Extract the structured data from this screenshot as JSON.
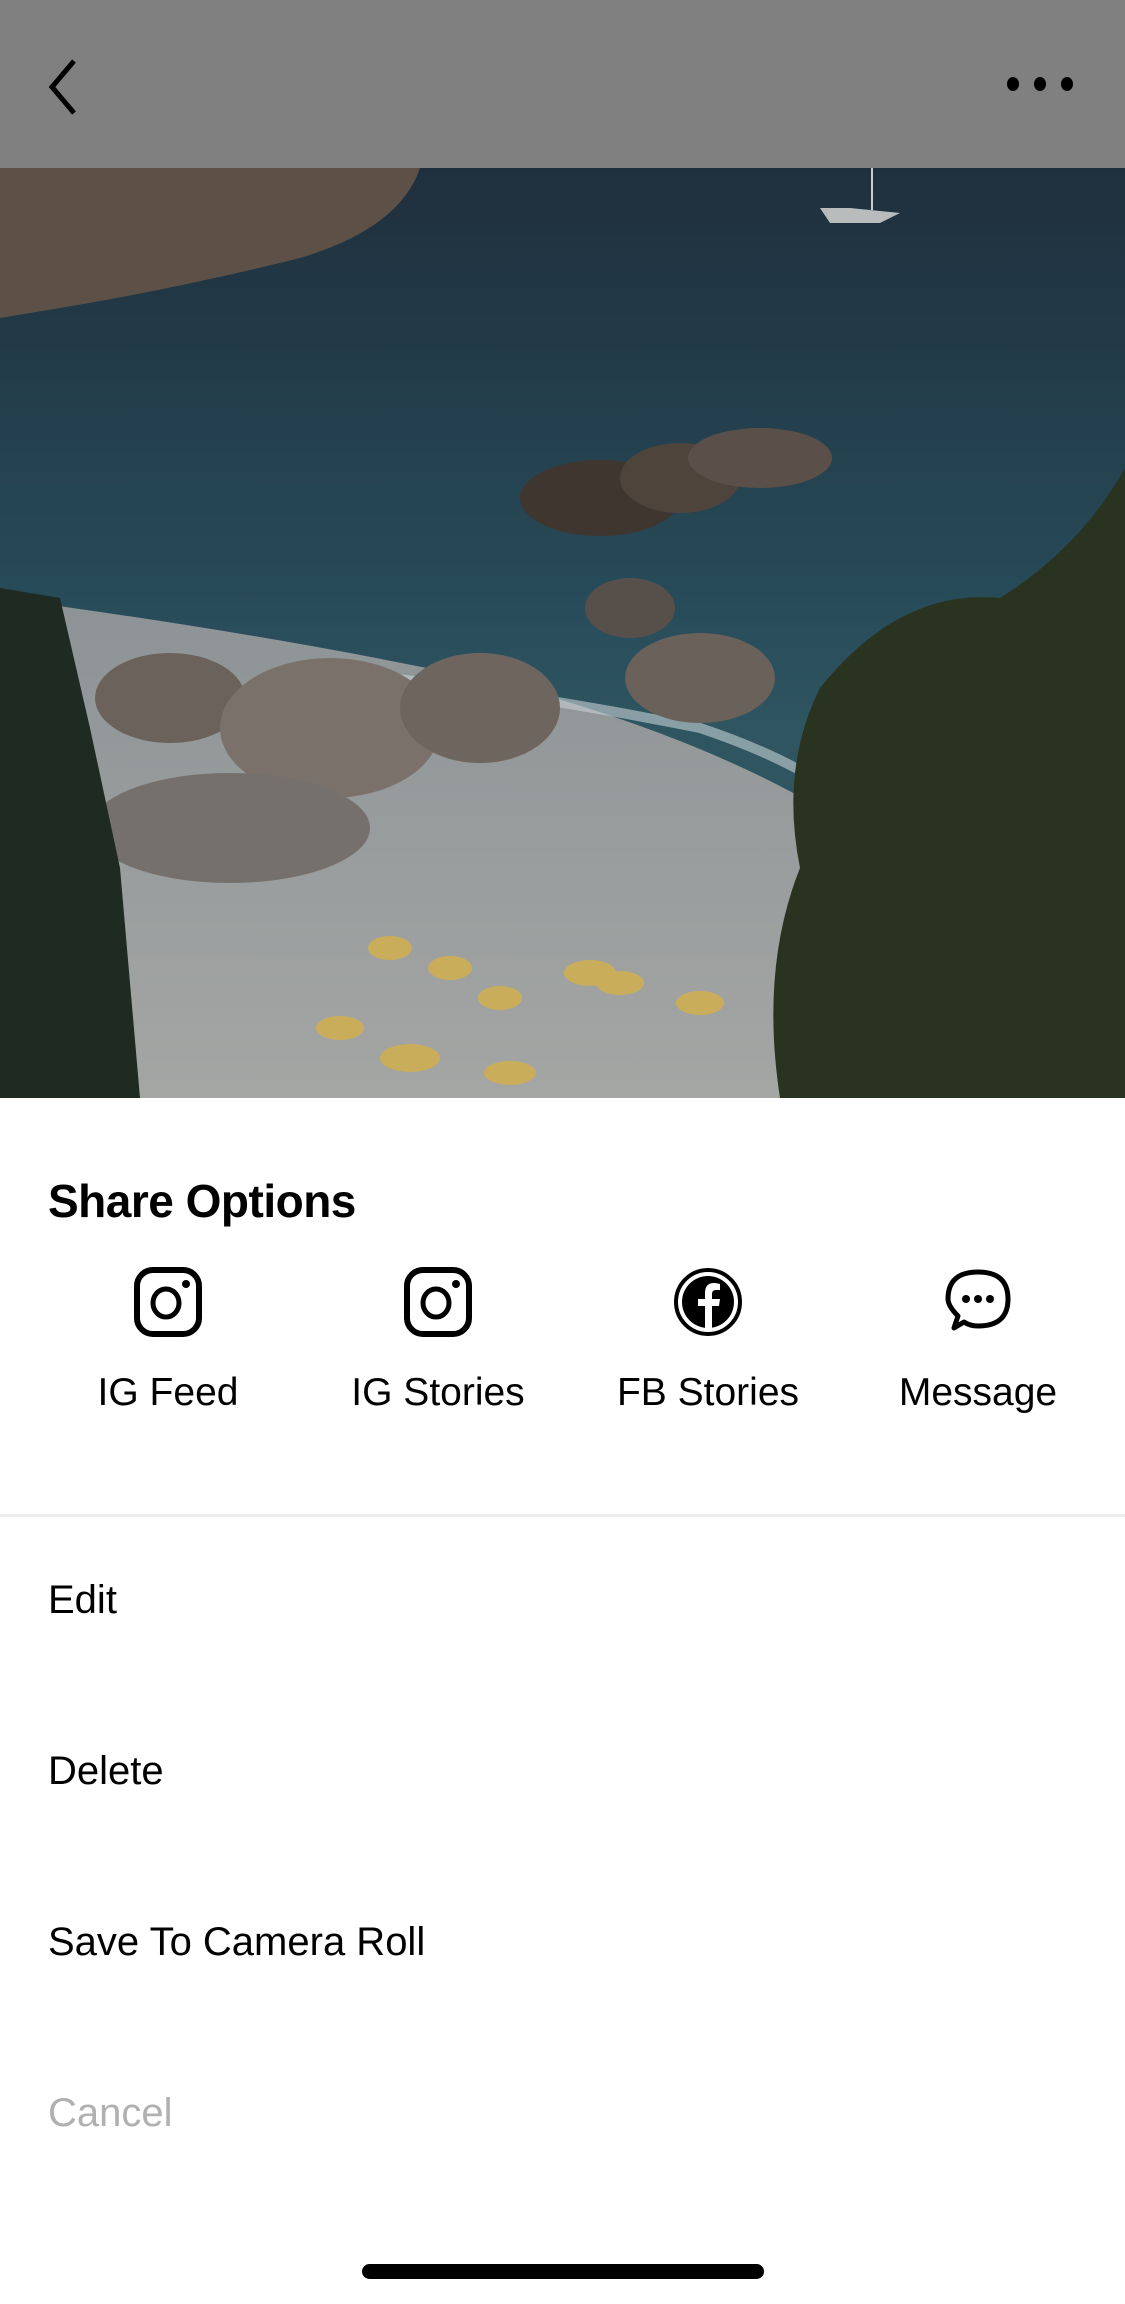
{
  "header": {
    "back_icon": "chevron-left-icon",
    "more_icon": "ellipsis-horizontal-icon"
  },
  "photo": {
    "description": "Beach with boulders, yellow umbrellas and ocean, dimmed overlay"
  },
  "sheet": {
    "title": "Share Options",
    "share_options": [
      {
        "label": "IG Feed",
        "icon": "instagram-icon"
      },
      {
        "label": "IG Stories",
        "icon": "instagram-icon"
      },
      {
        "label": "FB Stories",
        "icon": "facebook-icon"
      },
      {
        "label": "Message",
        "icon": "message-bubble-icon"
      }
    ],
    "actions": [
      {
        "label": "Edit"
      },
      {
        "label": "Delete"
      },
      {
        "label": "Save To Camera Roll"
      },
      {
        "label": "Cancel"
      }
    ]
  },
  "colors": {
    "header_overlay": "#808080",
    "cancel_text": "#b0b0b0",
    "divider": "#ececec"
  }
}
